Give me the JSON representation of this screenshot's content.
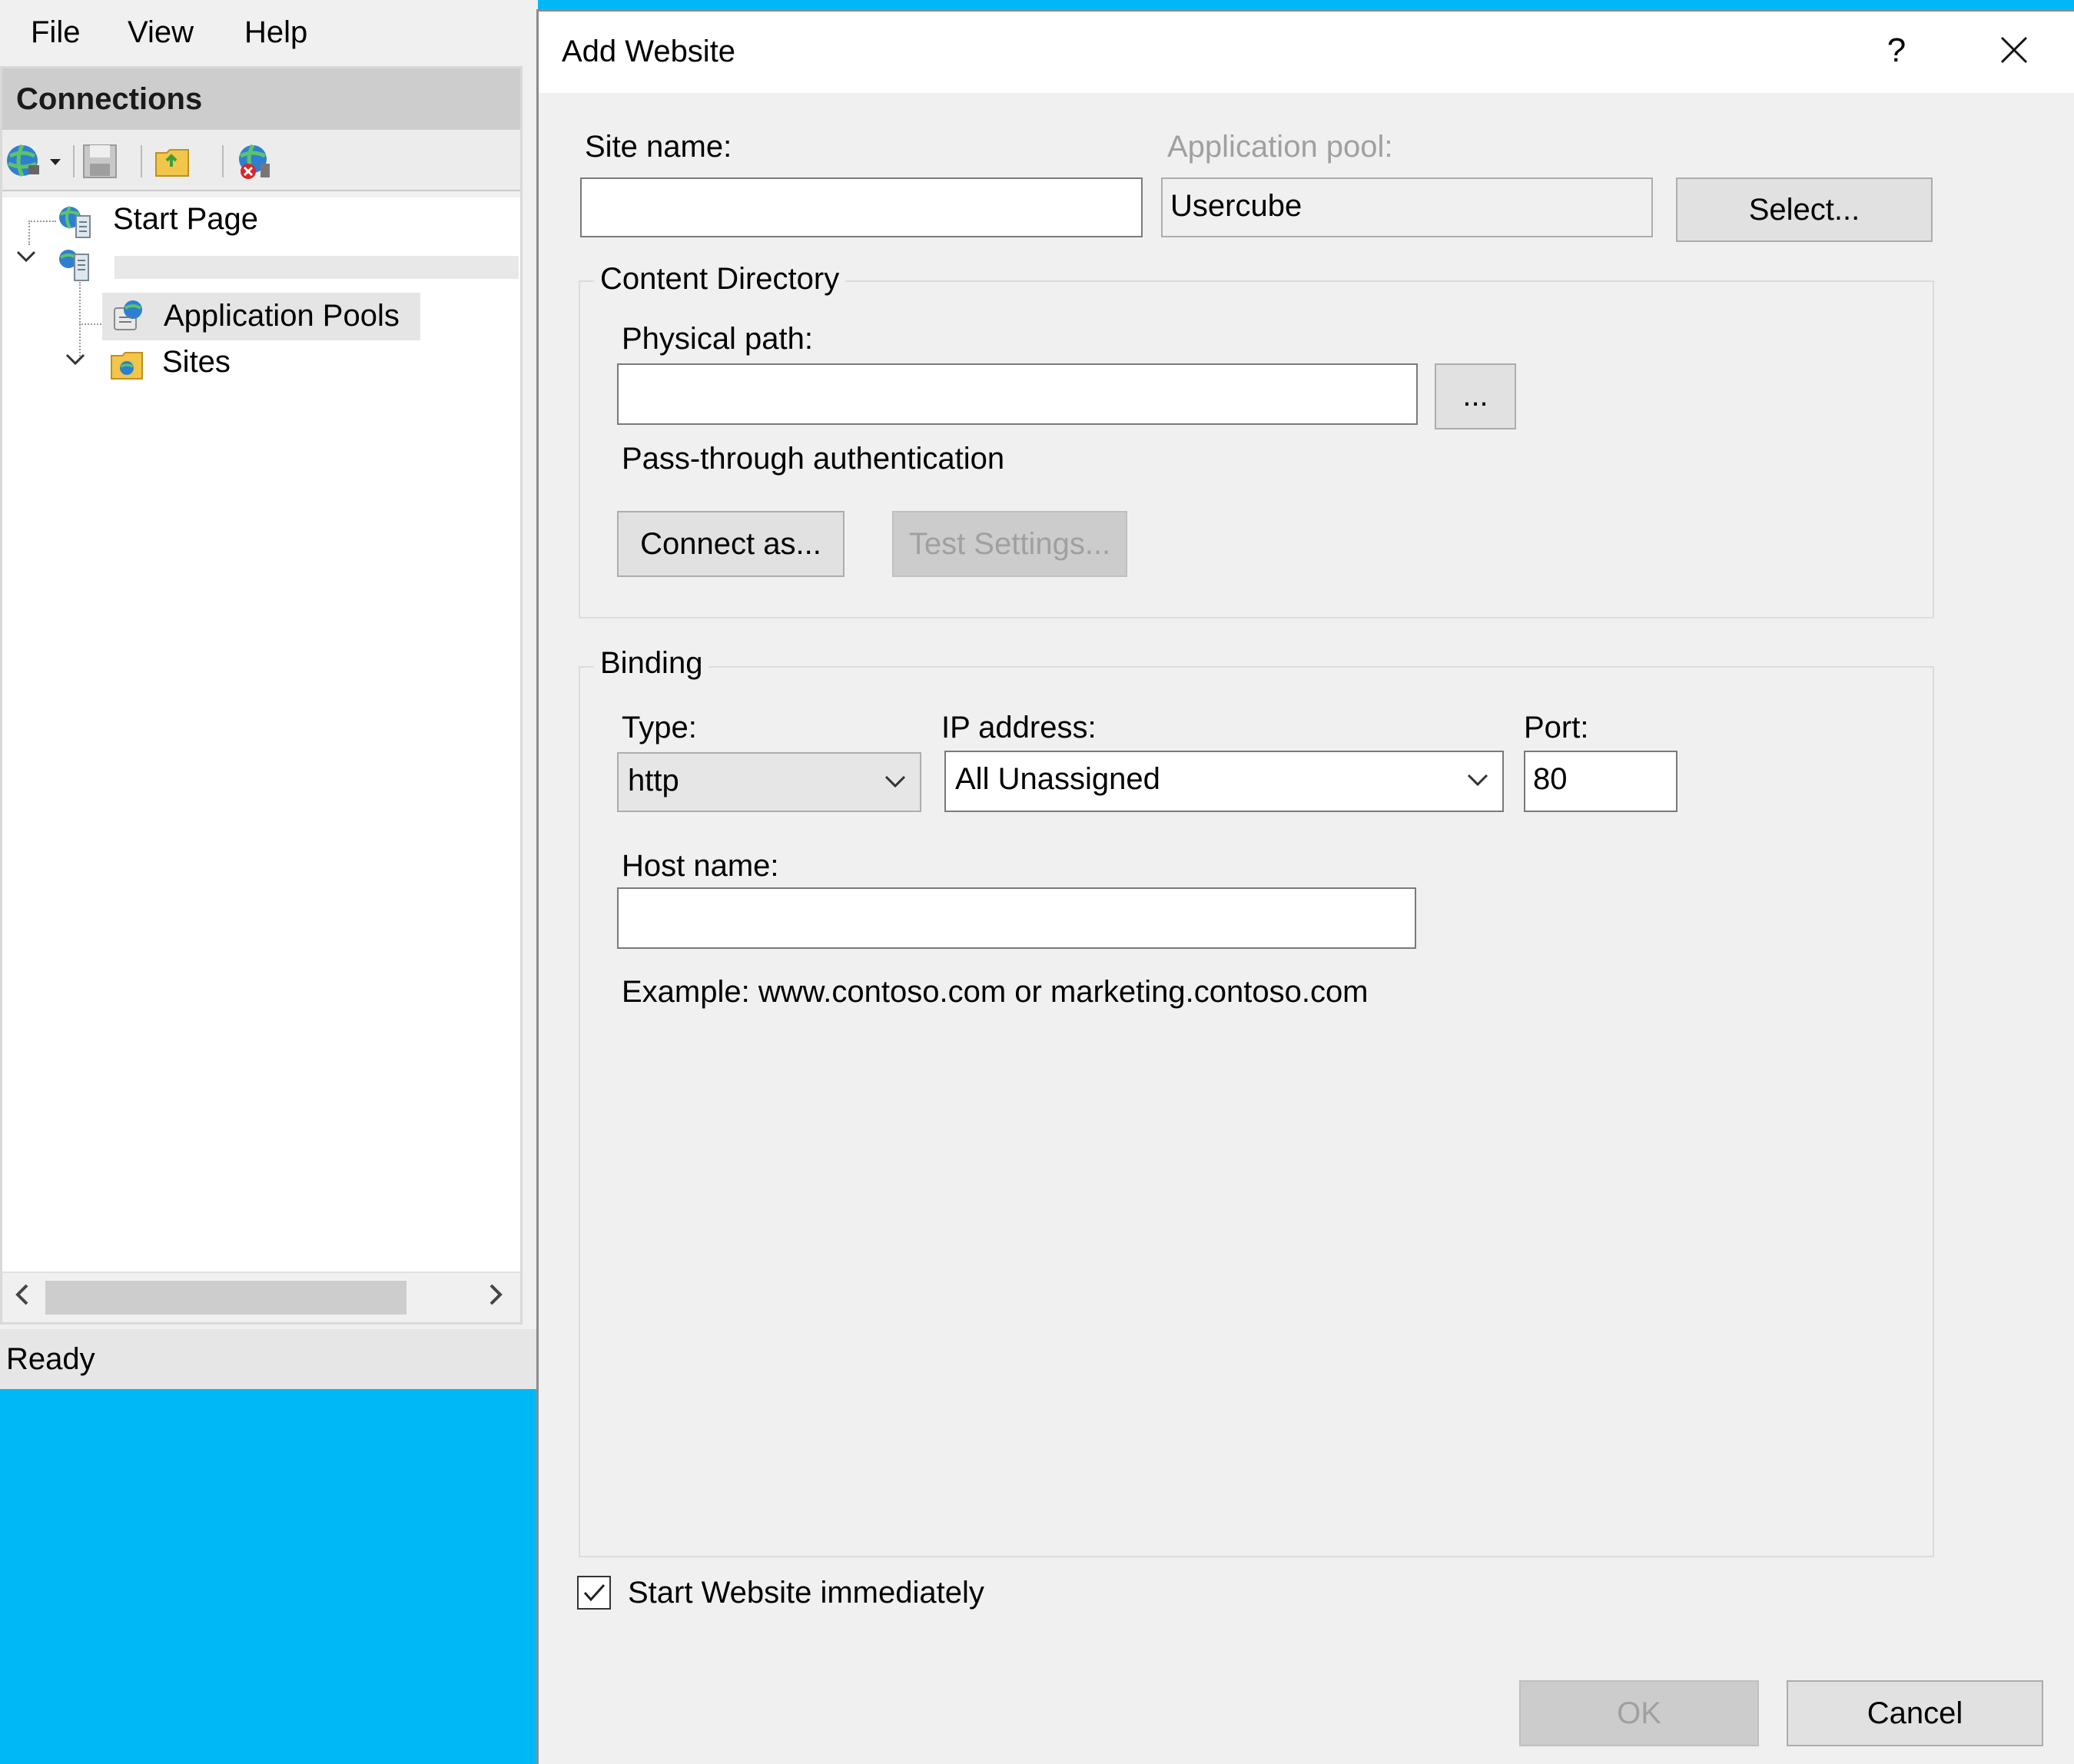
{
  "menubar": {
    "items": [
      "File",
      "View",
      "Help"
    ]
  },
  "connections": {
    "header": "Connections",
    "toolbar": {
      "icons": [
        "connect-globe-icon",
        "save-icon",
        "open-folder-icon",
        "disconnect-icon"
      ]
    },
    "tree": {
      "start_page": "Start Page",
      "server": "",
      "application_pools": "Application Pools",
      "sites": "Sites"
    }
  },
  "status": {
    "text": "Ready"
  },
  "dialog": {
    "title": "Add Website",
    "help": "?",
    "close": "✕",
    "site_name": {
      "label": "Site name:",
      "value": ""
    },
    "app_pool": {
      "label": "Application pool:",
      "value": "Usercube",
      "select_label": "Select..."
    },
    "content_directory": {
      "title": "Content Directory",
      "physical_path": {
        "label": "Physical path:",
        "value": "",
        "browse": "..."
      },
      "pass_through_label": "Pass-through authentication",
      "connect_as": "Connect as...",
      "test_settings": "Test Settings..."
    },
    "binding": {
      "title": "Binding",
      "type": {
        "label": "Type:",
        "value": "http"
      },
      "ip": {
        "label": "IP address:",
        "value": "All Unassigned"
      },
      "port": {
        "label": "Port:",
        "value": "80"
      },
      "host": {
        "label": "Host name:",
        "value": ""
      },
      "example": "Example: www.contoso.com or marketing.contoso.com"
    },
    "start_immediately": {
      "label": "Start Website immediately",
      "checked": true
    },
    "ok": "OK",
    "cancel": "Cancel"
  },
  "colors": {
    "desktop": "#00b8f5",
    "selection": "#e5e5e5",
    "disabled_text": "#a0a0a0"
  }
}
